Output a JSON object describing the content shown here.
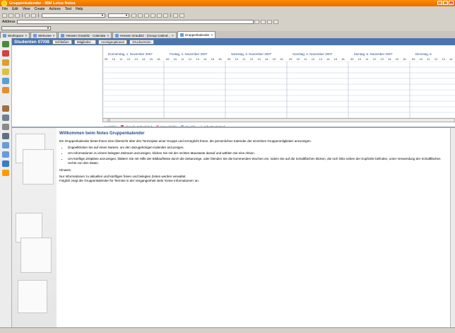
{
  "window": {
    "title": "Gruppenkalender - IBM Lotus Notes",
    "controls": [
      "_",
      "□",
      "×"
    ]
  },
  "menu": [
    "File",
    "Edit",
    "View",
    "Create",
    "Actions",
    "Text",
    "Help"
  ],
  "address": {
    "label": "Address",
    "value": ""
  },
  "tabs": [
    {
      "label": "Workspace",
      "active": false
    },
    {
      "label": "Welcome",
      "active": false
    },
    {
      "label": "Herwen Graubitz - Calendar",
      "active": false
    },
    {
      "label": "Herwen Graubitz - (Group Calend...",
      "active": false
    },
    {
      "label": "Gruppenkalender",
      "active": true
    }
  ],
  "schedule": {
    "title": "Studenten 07/08",
    "buttons": [
      "Schließen",
      "Mitglieder...",
      "Anzeigeoptionen",
      "Druckversion"
    ],
    "days": [
      "Donnerstag, 1. November 2007",
      "Freitag, 2. November 2007",
      "Samstag, 3. November 2007",
      "Sonntag, 4. November 2007",
      "Montag, 5. November 2007",
      "Dienstag, 6"
    ],
    "hours": [
      "09",
      "10",
      "11",
      "12",
      "13",
      "14",
      "15",
      "16"
    ],
    "legend": [
      {
        "label": "Available",
        "color": "#ffffff"
      },
      {
        "label": "Already Scheduled",
        "color": "#d9534f"
      },
      {
        "label": "Unavailable",
        "color": "#f0a6b8"
      },
      {
        "label": "No Info",
        "color": "#9fb7d8"
      },
      {
        "label": "Info Restricted",
        "color": "#e7e7e7"
      }
    ]
  },
  "doc": {
    "heading": "Willkommen beim Notes Gruppenkalender",
    "intro": "Ein Gruppenkalender bietet Ihnen eine Übersicht über den Terminplan einer Gruppe und ermöglicht Ihnen, die persönlichen Kalender der einzelnen Gruppenmitglieder anzuzeigen.",
    "bullets": [
      "Doppelklicken Sie auf einen Namen, um den dazugehörigen Kalender anzuzeigen.",
      "Um Informationen zu einem belegten Zeitraum anzuzeigen, klicken Sie mit der rechten Maustaste darauf und wählen Sie eine Aktion.",
      "Um künftige Zeitpläne anzuzeigen, blättern Sie mit Hilfe der Bildlaufleiste durch die Zeitanzeige, oder blenden Sie die kommenden Wochen ein, indem Sie auf die Schaltflächen klicken, die sich links neben der Kopfzeile befinden, unter Verwendung der Schaltflächen rechts von den Daten."
    ],
    "note_label": "Hinweis:",
    "note_lines": [
      "Nur Informationen zu aktuellen und künftigen freien und belegten Zeiten werden verwaltet.",
      "Folglich zeigt der Gruppenkalender für Termine in der Vergangenheit stets 'Keine Informationen' an."
    ]
  }
}
